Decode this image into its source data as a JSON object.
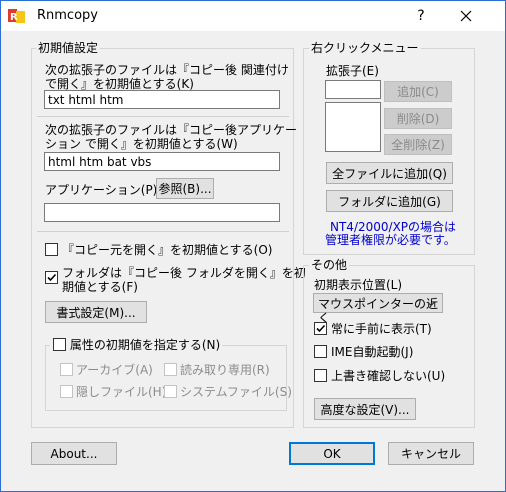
{
  "window": {
    "title": "Rnmcopy",
    "help_label": "?",
    "close_label": "✕"
  },
  "initial": {
    "legend": "初期値設定",
    "ext1_label_line1": "次の拡張子のファイルは『コピー後 関連付け",
    "ext1_label_line2": "で開く』を初期値とする(K)",
    "ext1_value": "txt html htm",
    "ext2_label_line1": "次の拡張子のファイルは『コピー後アプリケー",
    "ext2_label_line2": "ション で開く』を初期値とする(W)",
    "ext2_value": "html htm bat vbs",
    "app_label": "アプリケーション(P)",
    "browse_label": "参照(B)...",
    "app_value": "",
    "open_source_label": "『コピー元を開く』を初期値とする(O)",
    "open_source_checked": false,
    "folder_label_line1": "フォルダは『コピー後 フォルダを開く』を初",
    "folder_label_line2": "期値とする(F)",
    "folder_checked": true,
    "format_button": "書式設定(M)...",
    "attr_legend": "属性の初期値を指定する(N)",
    "attr_checked": false,
    "attrs": {
      "archive": "アーカイブ(A)",
      "readonly": "読み取り専用(R)",
      "hidden": "隠しファイル(H)",
      "system": "システムファイル(S)"
    }
  },
  "context_menu": {
    "legend": "右クリックメニュー",
    "ext_label": "拡張子(E)",
    "ext_value": "",
    "add_button": "追加(C)",
    "delete_button": "削除(D)",
    "delete_all_button": "全削除(Z)",
    "add_all_files_button": "全ファイルに追加(Q)",
    "add_folder_button": "フォルダに追加(G)",
    "note_line1": "NT4/2000/XPの場合は",
    "note_line2": "管理者権限が必要です。"
  },
  "other": {
    "legend": "その他",
    "position_label": "初期表示位置(L)",
    "position_value": "マウスポインターの近く",
    "topmost_label": "常に手前に表示(T)",
    "topmost_checked": true,
    "ime_label": "IME自動起動(J)",
    "ime_checked": false,
    "overwrite_label": "上書き確認しない(U)",
    "overwrite_checked": false,
    "advanced_button": "高度な設定(V)..."
  },
  "footer": {
    "about": "About...",
    "ok": "OK",
    "cancel": "キャンセル"
  },
  "colors": {
    "accent": "#0078d7",
    "note": "#0000cc",
    "window_border": "#2b6fd6"
  }
}
